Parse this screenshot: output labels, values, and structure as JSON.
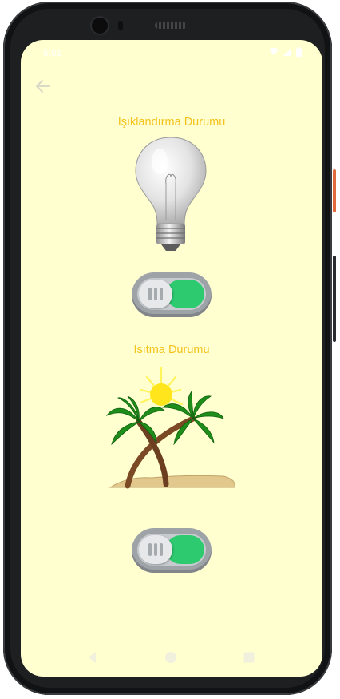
{
  "status_bar": {
    "time": "5:01",
    "icons": [
      "wifi-icon",
      "signal-icon",
      "battery-icon"
    ],
    "color": "#ffffff"
  },
  "toolbar": {
    "back_icon": "arrow-left-icon"
  },
  "lighting": {
    "title": "Işıklandırma Durumu",
    "image": "light-bulb",
    "switch_on": true
  },
  "heating": {
    "title": "Isıtma Durumu",
    "image": "palm-trees-sun",
    "switch_on": true
  },
  "navigation": {
    "buttons": [
      "back-triangle-icon",
      "home-circle-icon",
      "recents-square-icon"
    ]
  },
  "colors": {
    "background": "#ffffd0",
    "title": "#f5c21b",
    "switch_on": "#2dca70",
    "frame": "#1e1f21"
  }
}
